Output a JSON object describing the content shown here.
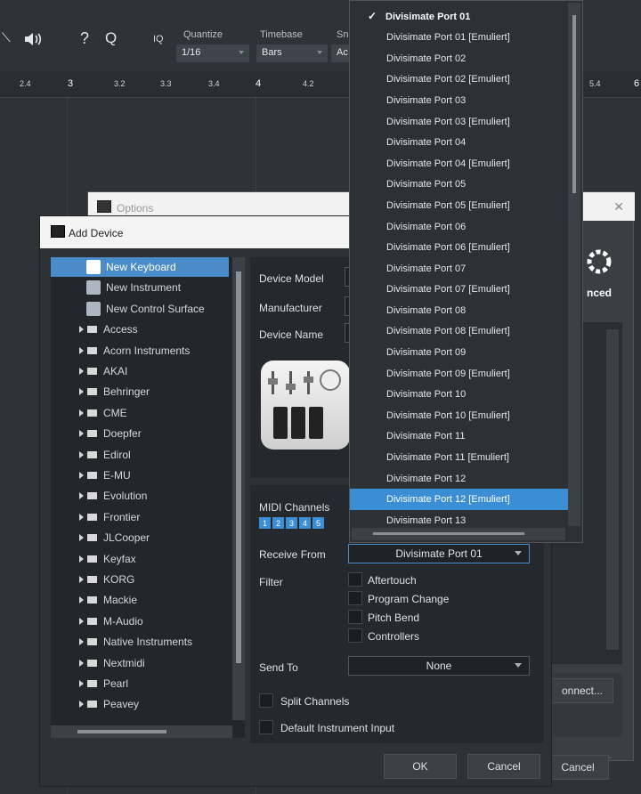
{
  "toolbar": {
    "help_glyph": "?",
    "find_glyph": "Q",
    "iq_label": "IQ",
    "quantize_label": "Quantize",
    "quantize_value": "1/16",
    "timebase_label": "Timebase",
    "timebase_value": "Bars",
    "snap_label": "Sn",
    "snap_value": "Ac"
  },
  "ruler": {
    "ticks": [
      "2.4",
      "3",
      "3.2",
      "3.3",
      "3.4",
      "4",
      "4.2",
      "5.4",
      "6"
    ]
  },
  "options_window": {
    "title": "Options",
    "close_glyph": "✕",
    "advanced_fragment": "nced",
    "connect_fragment": "onnect...",
    "cancel_label": "Cancel"
  },
  "add_device": {
    "title": "Add Device",
    "tree": [
      {
        "label": "New Keyboard",
        "kind": "keyboard-icon",
        "selected": true
      },
      {
        "label": "New Instrument",
        "kind": "instrument-icon"
      },
      {
        "label": "New Control Surface",
        "kind": "control-surface-icon"
      },
      {
        "label": "Access",
        "kind": "folder"
      },
      {
        "label": "Acorn Instruments",
        "kind": "folder"
      },
      {
        "label": "AKAI",
        "kind": "folder"
      },
      {
        "label": "Behringer",
        "kind": "folder"
      },
      {
        "label": "CME",
        "kind": "folder"
      },
      {
        "label": "Doepfer",
        "kind": "folder"
      },
      {
        "label": "Edirol",
        "kind": "folder"
      },
      {
        "label": "E-MU",
        "kind": "folder"
      },
      {
        "label": "Evolution",
        "kind": "folder"
      },
      {
        "label": "Frontier",
        "kind": "folder"
      },
      {
        "label": "JLCooper",
        "kind": "folder"
      },
      {
        "label": "Keyfax",
        "kind": "folder"
      },
      {
        "label": "KORG",
        "kind": "folder"
      },
      {
        "label": "Mackie",
        "kind": "folder"
      },
      {
        "label": "M-Audio",
        "kind": "folder"
      },
      {
        "label": "Native Instruments",
        "kind": "folder"
      },
      {
        "label": "Nextmidi",
        "kind": "folder"
      },
      {
        "label": "Pearl",
        "kind": "folder"
      },
      {
        "label": "Peavey",
        "kind": "folder"
      }
    ],
    "device_model_label": "Device Model",
    "manufacturer_label": "Manufacturer",
    "device_name_label": "Device Name",
    "midi_channels_label": "MIDI Channels",
    "channels": [
      "1",
      "2",
      "3",
      "4",
      "5"
    ],
    "receive_from_label": "Receive From",
    "receive_from_value": "Divisimate Port 01",
    "filter_label": "Filter",
    "filters": [
      "Aftertouch",
      "Program Change",
      "Pitch Bend",
      "Controllers"
    ],
    "send_to_label": "Send To",
    "send_to_value": "None",
    "split_channels_label": "Split Channels",
    "default_instrument_input_label": "Default Instrument Input",
    "ok_label": "OK",
    "cancel_label": "Cancel"
  },
  "port_dropdown": {
    "checkmark": "✓",
    "items": [
      "Divisimate Port 01",
      "Divisimate Port 01 [Emuliert]",
      "Divisimate Port 02",
      "Divisimate Port 02 [Emuliert]",
      "Divisimate Port 03",
      "Divisimate Port 03 [Emuliert]",
      "Divisimate Port 04",
      "Divisimate Port 04 [Emuliert]",
      "Divisimate Port 05",
      "Divisimate Port 05 [Emuliert]",
      "Divisimate Port 06",
      "Divisimate Port 06 [Emuliert]",
      "Divisimate Port 07",
      "Divisimate Port 07 [Emuliert]",
      "Divisimate Port 08",
      "Divisimate Port 08 [Emuliert]",
      "Divisimate Port 09",
      "Divisimate Port 09 [Emuliert]",
      "Divisimate Port 10",
      "Divisimate Port 10 [Emuliert]",
      "Divisimate Port 11",
      "Divisimate Port 11 [Emuliert]",
      "Divisimate Port 12",
      "Divisimate Port 12 [Emuliert]",
      "Divisimate Port 13"
    ],
    "selected_index": 0,
    "highlighted_index": 23
  }
}
